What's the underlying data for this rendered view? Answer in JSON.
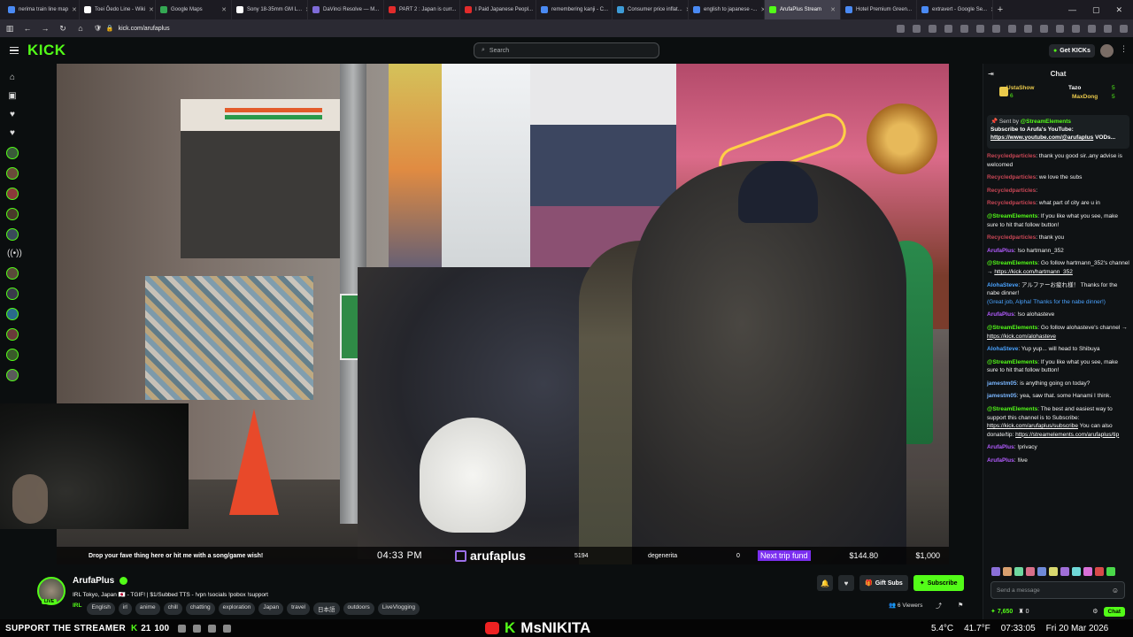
{
  "browser": {
    "tabs": [
      {
        "label": "nerima train line map",
        "color": "#4a8af4"
      },
      {
        "label": "Toei Ōedo Line - Wiki",
        "color": "#ffffff"
      },
      {
        "label": "Google Maps",
        "color": "#34a853"
      },
      {
        "label": "Sony 18-35mm GM L...",
        "color": "#ffffff"
      },
      {
        "label": "DaVinci Resolve — M...",
        "color": "#7f6bd8"
      },
      {
        "label": "PART 2 : Japan is curr...",
        "color": "#e22b2b"
      },
      {
        "label": "I Paid Japanese Peopl...",
        "color": "#e22b2b"
      },
      {
        "label": "remembering kanji - C...",
        "color": "#4a8af4"
      },
      {
        "label": "Consumer price inflat...",
        "color": "#3d9bd6"
      },
      {
        "label": "english to japanese -...",
        "color": "#4a8af4"
      },
      {
        "label": "ArufaPlus Stream",
        "color": "#53fc18",
        "active": true
      },
      {
        "label": "Hotel Premium Green...",
        "color": "#4a8af4"
      },
      {
        "label": "extravert - Google Se...",
        "color": "#4a8af4"
      }
    ],
    "url": "kick.com/arufaplus"
  },
  "header": {
    "logo": "KICK",
    "search_placeholder": "Search",
    "get_kicks": "Get KICKs"
  },
  "video": {
    "overlay_message": "Drop your fave thing here or hit me with a song/game wish!",
    "clock": "04:33 PM",
    "brand": "arufaplus",
    "sub_count": "5194",
    "recent_name": "degenerita",
    "zero": "0",
    "goal_label": "Next trip fund",
    "goal_current": "$144.80",
    "goal_target": "$1,000"
  },
  "chat": {
    "title": "Chat",
    "gifters": {
      "first": {
        "name": "UstaShow",
        "count": "6"
      },
      "second": {
        "name": "Tazo",
        "count": "5"
      },
      "third": {
        "name": "MaxDong",
        "count": "5"
      }
    },
    "pinned": {
      "sent_by_label": "Sent by",
      "sent_by_user": "@StreamElements",
      "text": "Subscribe to Arufa's YouTube:",
      "link": "https://www.youtube.com/@arufaplus",
      "tail": "VODs..."
    },
    "messages": [
      {
        "user": "Recycledparticles",
        "cls": "u-r",
        "text": ": thank you good sir..any advise is welcomed"
      },
      {
        "user": "Recycledparticles",
        "cls": "u-r",
        "text": ": we love the subs"
      },
      {
        "user": "Recycledparticles",
        "cls": "u-r",
        "text": ": "
      },
      {
        "user": "Recycledparticles",
        "cls": "u-r",
        "text": ": what part of city are u in"
      },
      {
        "user": "@StreamElements",
        "cls": "u-s",
        "text": ": If you like what you see, make sure to hit that follow button!"
      },
      {
        "user": "Recycledparticles",
        "cls": "u-r",
        "text": ": thank you"
      },
      {
        "user": "ArufaPlus",
        "cls": "u-a",
        "text": ": !so hartmann_352"
      },
      {
        "user": "@StreamElements",
        "cls": "u-s",
        "text": ": Go follow hartmann_352's channel →",
        "link": "https://kick.com/hartmann_352"
      },
      {
        "user": "AlohaSteve",
        "cls": "u-al",
        "text": ": アルファーお疲れ様！ Thanks for the nabe dinner!",
        "extra": "(Great job, Alpha! Thanks for the nabe dinner!)"
      },
      {
        "user": "ArufaPlus",
        "cls": "u-a",
        "text": ": !so alohasteve"
      },
      {
        "user": "@StreamElements",
        "cls": "u-s",
        "text": ": Go follow alohasteve's channel →",
        "link": "https://kick.com/alohasteve"
      },
      {
        "user": "AlohaSteve",
        "cls": "u-al",
        "text": ": Yup yup... will head to Shibuya"
      },
      {
        "user": "@StreamElements",
        "cls": "u-s",
        "text": ": If you like what you see, make sure to hit that follow button!"
      },
      {
        "user": "jamestm05",
        "cls": "u-j",
        "text": ": is anything going on today?"
      },
      {
        "user": "jamestm05",
        "cls": "u-j",
        "text": ": yea, saw that. some Hanami I think."
      },
      {
        "user": "@StreamElements",
        "cls": "u-s",
        "text": ": The best and easiest way to support this channel is to Subscribe:",
        "link": "https://kick.com/arufaplus/subscribe",
        "tail": "You can also donate/tip:",
        "link2": "https://streamelements.com/arufaplus/tip"
      },
      {
        "user": "ArufaPlus",
        "cls": "u-a",
        "text": ": !privacy"
      },
      {
        "user": "ArufaPlus",
        "cls": "u-a",
        "text": ": !live"
      }
    ],
    "send_placeholder": "Send a message",
    "points": "7,650",
    "zero": "0",
    "chat_button": "Chat"
  },
  "channel": {
    "name": "ArufaPlus",
    "live_badge": "LIVE",
    "title": "IRL Tokyo, Japan 🇯🇵 - TGIF! | $1/Subbed TTS - !vpn !socials !pobox !support",
    "category": "IRL",
    "tags": [
      "English",
      "irl",
      "anime",
      "chill",
      "chatting",
      "exploration",
      "Japan",
      "travel",
      "日本語",
      "outdoors",
      "LiveVlogging"
    ],
    "gift_subs": "Gift Subs",
    "subscribe": "Subscribe",
    "viewers": "6 Viewers"
  },
  "taskbar": {
    "support": "SUPPORT THE STREAMER",
    "k": "K",
    "count1": "21",
    "count2": "100",
    "center_name": "MsNIKITA",
    "temp": "5.4°C",
    "humidity": "41.7°F",
    "time": "07:33:05",
    "date": "Fri 20 Mar 2026"
  }
}
